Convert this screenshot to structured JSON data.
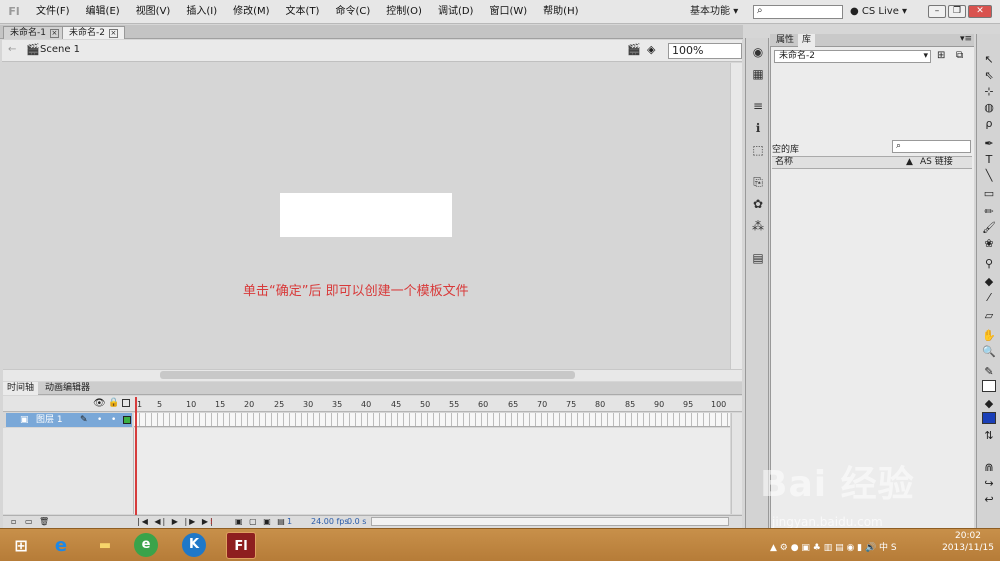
{
  "app": {
    "logo": "Fl"
  },
  "menus": [
    "文件(F)",
    "编辑(E)",
    "视图(V)",
    "插入(I)",
    "修改(M)",
    "文本(T)",
    "命令(C)",
    "控制(O)",
    "调试(D)",
    "窗口(W)",
    "帮助(H)"
  ],
  "workspace": "基本功能",
  "search_placeholder": "",
  "cslive": "CS Live",
  "doc_tabs": [
    "未命名-1",
    "未命名-2"
  ],
  "scene": "Scene 1",
  "zoom": "100%",
  "caption": "单击“确定”后   即可以创建一个模板文件",
  "timeline": {
    "tabs": [
      "时间轴",
      "动画编辑器"
    ],
    "ruler": [
      "1",
      "5",
      "10",
      "15",
      "20",
      "25",
      "30",
      "35",
      "40",
      "45",
      "50",
      "55",
      "60",
      "65",
      "70",
      "75",
      "80",
      "85",
      "90",
      "95",
      "100"
    ],
    "layer_name": "图层 1",
    "footer": {
      "frame": "1",
      "fps": "24.00 fps",
      "time": "0.0 s"
    }
  },
  "panel": {
    "tabs": [
      "属性",
      "库"
    ],
    "library_doc": "未命名-2",
    "empty_label": "空的库",
    "col_name": "名称",
    "col_link": "AS 链接"
  },
  "taskbar": {
    "time": "20:02",
    "date": "2013/11/15",
    "flash_icon": "Fl"
  },
  "watermark": {
    "text": "Bai 经验",
    "url": "jingyan.baidu.com"
  }
}
